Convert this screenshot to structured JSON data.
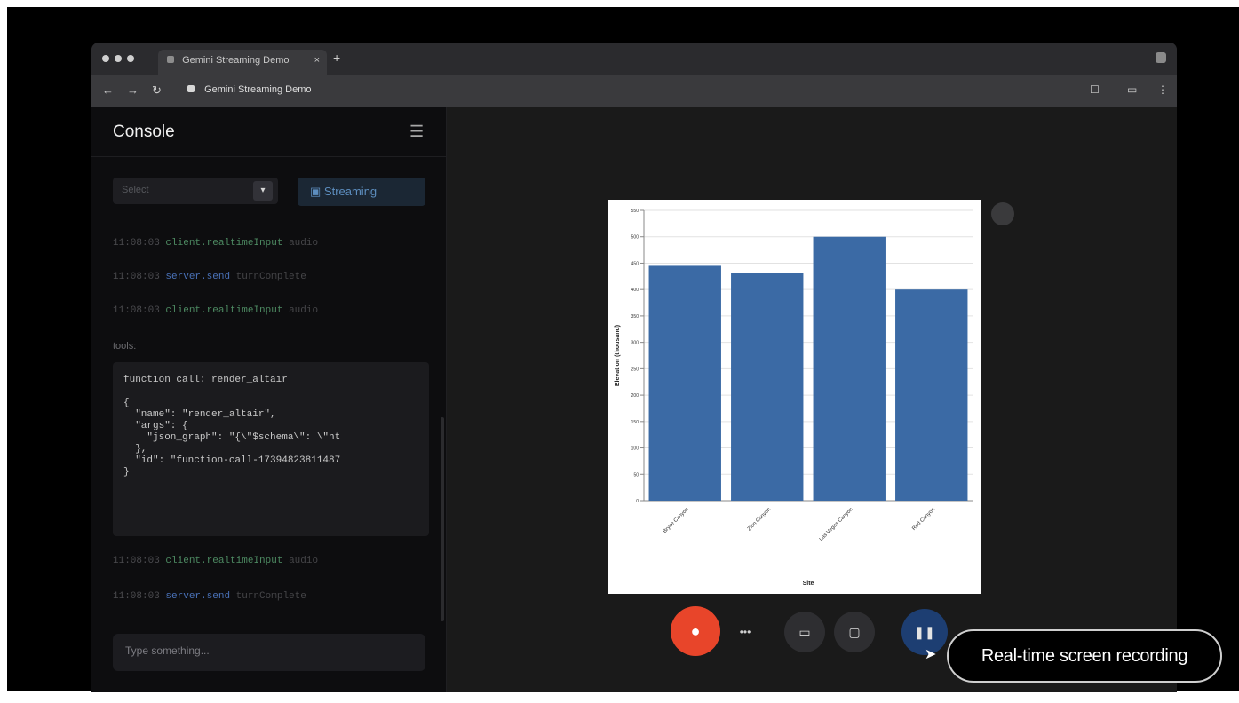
{
  "browser": {
    "tab_title": "Gemini Streaming Demo",
    "tab_close_icon": "close-icon",
    "address": "Gemini Streaming Demo",
    "colors": {
      "chrome": "#2b2b2e",
      "page": "#1a1a1a"
    }
  },
  "console": {
    "title": "Console",
    "select_placeholder": "Select",
    "stream_button": "Streaming",
    "logs": [
      {
        "time": "11:08:03",
        "prefix": "client.",
        "method": "realtimeInput",
        "tail": " audio",
        "color": "green"
      },
      {
        "time": "11:08:03",
        "prefix": "server.",
        "method": "send",
        "tail": " turnComplete",
        "color": "blue"
      },
      {
        "time": "11:08:03",
        "prefix": "client.",
        "method": "realtimeInput",
        "tail": " audio",
        "color": "green"
      }
    ],
    "section_label": "tools:",
    "code": "function call: render_altair\n\n{\n  \"name\": \"render_altair\",\n  \"args\": {\n    \"json_graph\": \"{\\\"$schema\\\": \\\"ht\n  },\n  \"id\": \"function-call-17394823811487\n}",
    "logs_after": [
      {
        "time": "11:08:03",
        "prefix": "client.",
        "method": "realtimeInput",
        "tail": " audio",
        "color": "green"
      },
      {
        "time": "11:08:03",
        "prefix": "server.",
        "method": "send",
        "tail": " turnComplete",
        "color": "blue"
      }
    ],
    "input_placeholder": "Type something..."
  },
  "controls": {
    "mic_icon": "mic-icon",
    "more_icon": "more-icon",
    "screen_icon": "screen-share-icon",
    "camera_icon": "camera-icon",
    "pause_icon": "pause-icon"
  },
  "tooltip": "Real-time screen recording",
  "chart_data": {
    "type": "bar",
    "categories": [
      "Bryce Canyon",
      "Zion Canyon",
      "Las Vegas Canyon",
      "Red Canyon"
    ],
    "values": [
      445,
      432,
      500,
      400
    ],
    "ylim": [
      0,
      550
    ],
    "yticks": [
      0,
      50,
      100,
      150,
      200,
      250,
      300,
      350,
      400,
      450,
      500,
      550
    ],
    "xlabel": "Site",
    "ylabel": "Elevation (thousand)",
    "grid": true,
    "bar_color": "#3b6aa5"
  }
}
